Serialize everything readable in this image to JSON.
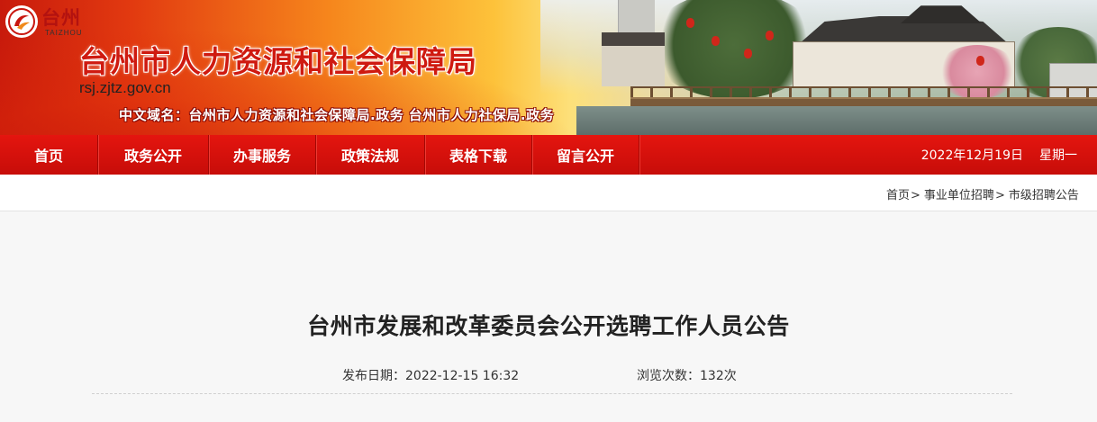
{
  "header": {
    "logo_text": "台州",
    "logo_sub": "TAIZHOU",
    "title": "台州市人力资源和社会保障局",
    "domain": "rsj.zjtz.gov.cn",
    "cn_domain": "中文域名：台州市人力资源和社会保障局.政务   台州市人力社保局.政务"
  },
  "nav": {
    "items": [
      {
        "label": "首页"
      },
      {
        "label": "政务公开"
      },
      {
        "label": "办事服务"
      },
      {
        "label": "政策法规"
      },
      {
        "label": "表格下载"
      },
      {
        "label": "留言公开"
      }
    ],
    "date": "2022年12月19日",
    "weekday": "星期一"
  },
  "breadcrumb": {
    "items": [
      "首页",
      "事业单位招聘",
      "市级招聘公告"
    ],
    "separator": ">"
  },
  "article": {
    "title": "台州市发展和改革委员会公开选聘工作人员公告",
    "publish_label": "发布日期：",
    "publish_value": "2022-12-15 16:32",
    "views_label": "浏览次数：",
    "views_value": "132次"
  },
  "colors": {
    "nav_red": "#d4110c",
    "title_red": "#cf1a10"
  }
}
